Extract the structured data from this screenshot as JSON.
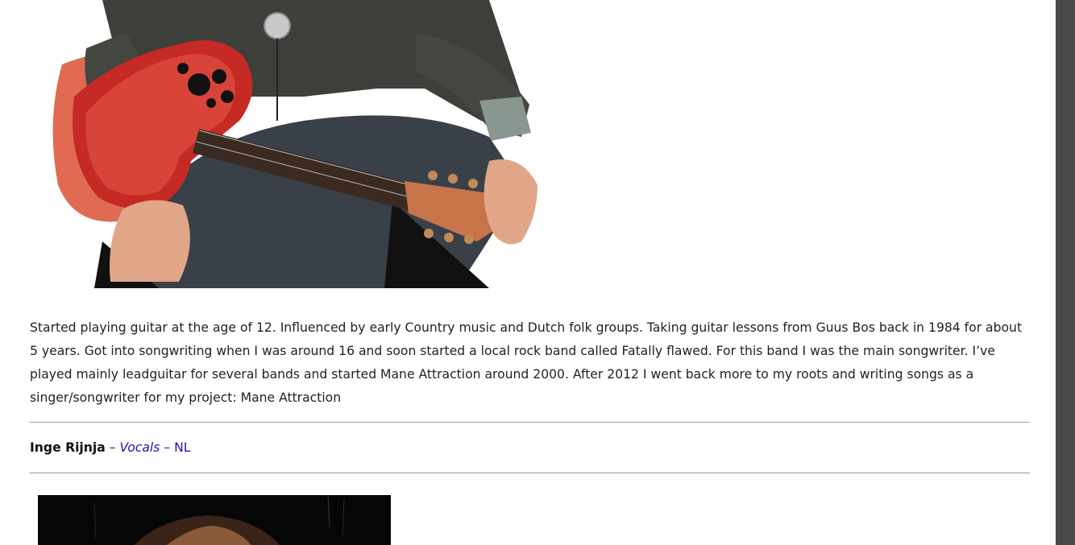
{
  "bio": {
    "text": "Started playing guitar at the age of 12. Influenced by early Country music and Dutch folk groups. Taking guitar lessons from Guus Bos back in 1984 for about 5 years. Got into songwriting when I was around 16 and soon started a local rock band called Fatally flawed. For this band I was the main songwriter. I’ve played mainly leadguitar for several bands and started Mane Attraction around 2000. After 2012  I went back more to my roots and writing songs as a singer/songwriter for my project: Mane Attraction"
  },
  "member": {
    "name": "Inge Rijnja",
    "separator1": " – ",
    "role": "Vocals",
    "separator2": " – ",
    "country": "NL"
  },
  "colors": {
    "link": "#1a1aa8",
    "rule": "#9a9a9a",
    "scrollbar": "#4a4a4a"
  }
}
